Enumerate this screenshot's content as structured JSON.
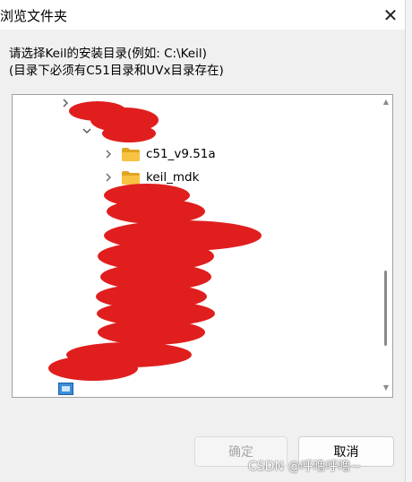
{
  "window": {
    "title": "浏览文件夹",
    "close_glyph": "✕"
  },
  "instructions": {
    "line1": "请选择Keil的安装目录(例如: C:\\Keil)",
    "line2": "(目录下必须有C51目录和UVx目录存在)"
  },
  "tree": {
    "items": [
      {
        "label": "",
        "icon": "chevron-right-icon"
      },
      {
        "label": "",
        "icon": "chevron-down-icon"
      },
      {
        "label": "c51_v9.51a",
        "icon": "folder-icon"
      },
      {
        "label": "keil_mdk",
        "icon": "folder-icon"
      }
    ],
    "redaction_color": "#e01e1e"
  },
  "buttons": {
    "ok": "确定",
    "cancel": "取消"
  },
  "watermark": "CSDN @呼噜呼噜~",
  "colors": {
    "folder": "#f8c342",
    "folder_dark": "#e0a520",
    "redaction": "#e01e1e"
  }
}
